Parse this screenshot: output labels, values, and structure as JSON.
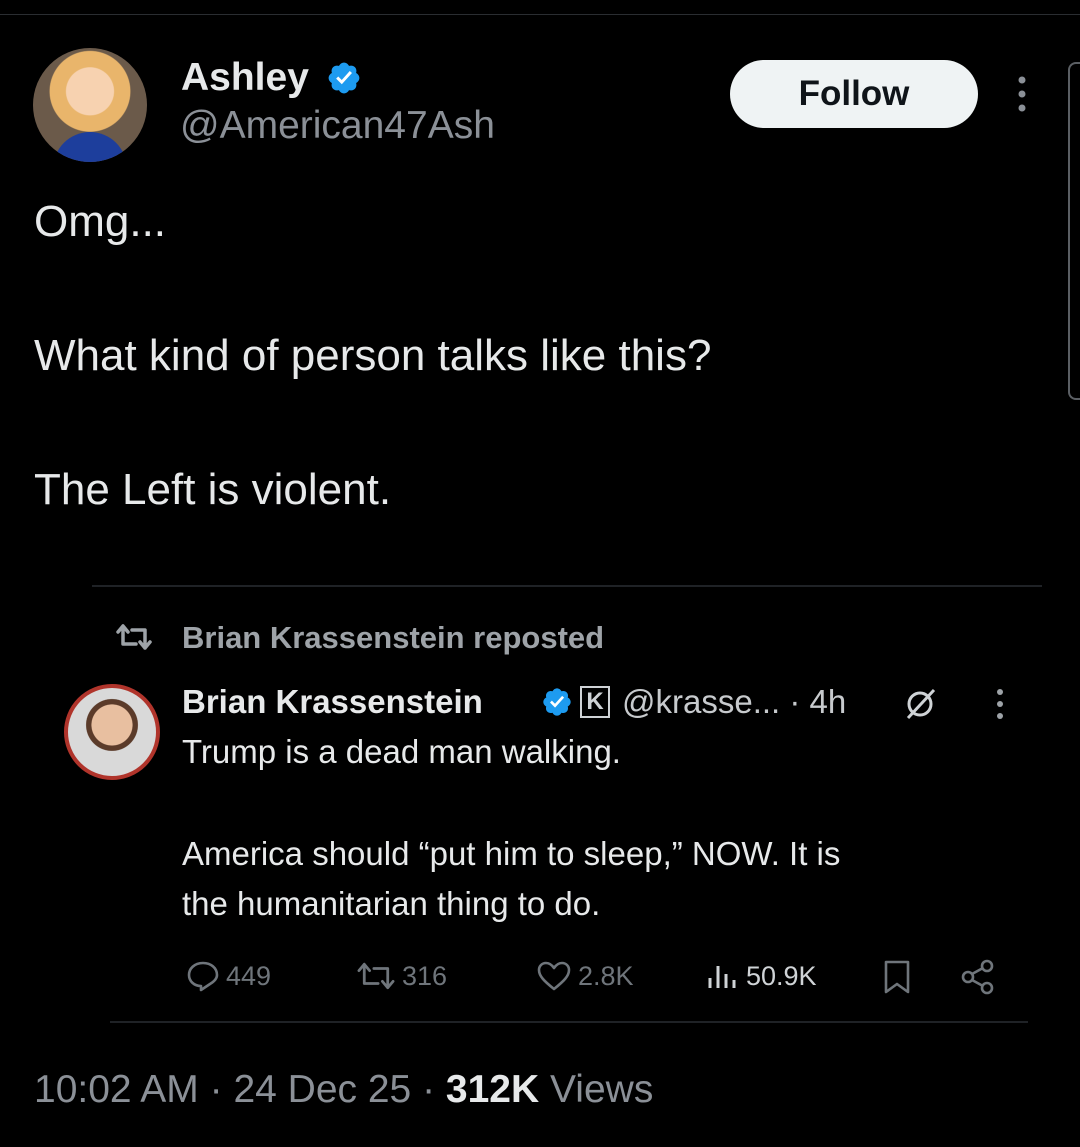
{
  "author": {
    "display_name": "Ashley",
    "handle": "@American47Ash"
  },
  "follow_label": "Follow",
  "tweet": {
    "lines": [
      "Omg...",
      "What kind of person talks like this?",
      "The Left is violent."
    ]
  },
  "quoted": {
    "repost_text": "Brian Krassenstein reposted",
    "name": "Brian Krassenstein",
    "badge_letter": "K",
    "handle_time": "@krasse... · 4h",
    "lines": [
      "Trump is a dead man walking.",
      "America should “put him to sleep,” NOW.  It is",
      "the humanitarian thing to do."
    ],
    "actions": {
      "replies": "449",
      "reposts": "316",
      "likes": "2.8K",
      "views": "50.9K"
    }
  },
  "meta": {
    "time": "10:02 AM",
    "sep1": " · ",
    "date": "24 Dec 25",
    "sep2": " · ",
    "views_count": "312K",
    "views_label": " Views"
  },
  "colors": {
    "background": "#000000",
    "verified": "#1d9bf0",
    "muted": "#8b9097"
  },
  "icons": [
    "verified-icon",
    "more-icon",
    "repost-icon",
    "slash-icon",
    "reply-icon",
    "like-icon",
    "views-icon",
    "bookmark-icon",
    "share-icon"
  ]
}
